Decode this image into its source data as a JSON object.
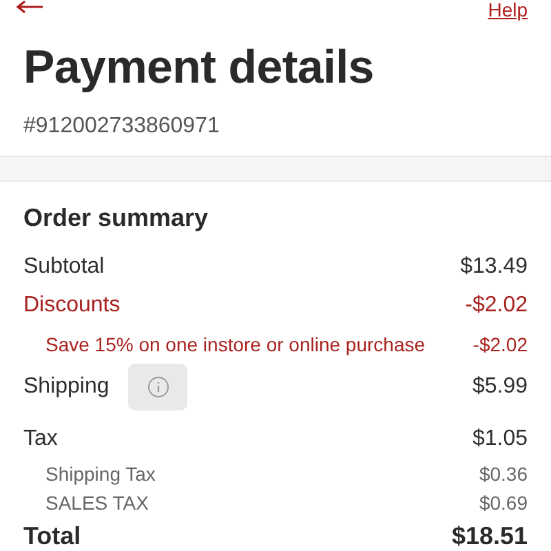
{
  "top_bar": {
    "help_link": "Help"
  },
  "title": "Payment details",
  "order_number": "#912002733860971",
  "summary": {
    "heading": "Order summary",
    "rows": [
      {
        "kind": "main",
        "label": "Subtotal",
        "amount": "$13.49"
      },
      {
        "kind": "discount",
        "label": "Discounts",
        "amount": "-$2.02"
      },
      {
        "kind": "discount-detail",
        "label": "Save 15% on one instore or online purchase",
        "amount": "-$2.02"
      },
      {
        "kind": "info",
        "label": "Shipping",
        "amount": "$5.99"
      },
      {
        "kind": "main",
        "label": "Tax",
        "amount": "$1.05"
      },
      {
        "kind": "detail",
        "label": "Shipping Tax",
        "amount": "$0.36"
      },
      {
        "kind": "detail",
        "label": "SALES TAX",
        "amount": "$0.69"
      },
      {
        "kind": "total",
        "label": "Total",
        "amount": "$18.51"
      }
    ]
  }
}
